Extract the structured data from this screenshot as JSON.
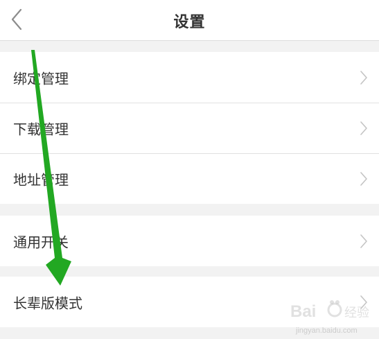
{
  "header": {
    "title": "设置",
    "back_icon": "chevron-left-icon"
  },
  "settings": {
    "groups": [
      {
        "items": [
          {
            "label": "绑定管理",
            "icon": "chevron-right-icon"
          },
          {
            "label": "下载管理",
            "icon": "chevron-right-icon"
          },
          {
            "label": "地址管理",
            "icon": "chevron-right-icon"
          }
        ]
      },
      {
        "items": [
          {
            "label": "通用开关",
            "icon": "chevron-right-icon"
          }
        ]
      },
      {
        "items": [
          {
            "label": "长辈版模式",
            "icon": "chevron-right-icon"
          }
        ]
      }
    ]
  },
  "overlay": {
    "arrow_icon": "green-arrow-annotation-icon",
    "arrow_color": "#22a822"
  },
  "watermark": {
    "logo": "baidu-jingyan-watermark",
    "url": "jingyan.baidu.com"
  },
  "colors": {
    "background": "#f2f2f2",
    "surface": "#ffffff",
    "divider": "#e1e1e1",
    "text": "#333333",
    "chevron": "#c4c4c4"
  }
}
